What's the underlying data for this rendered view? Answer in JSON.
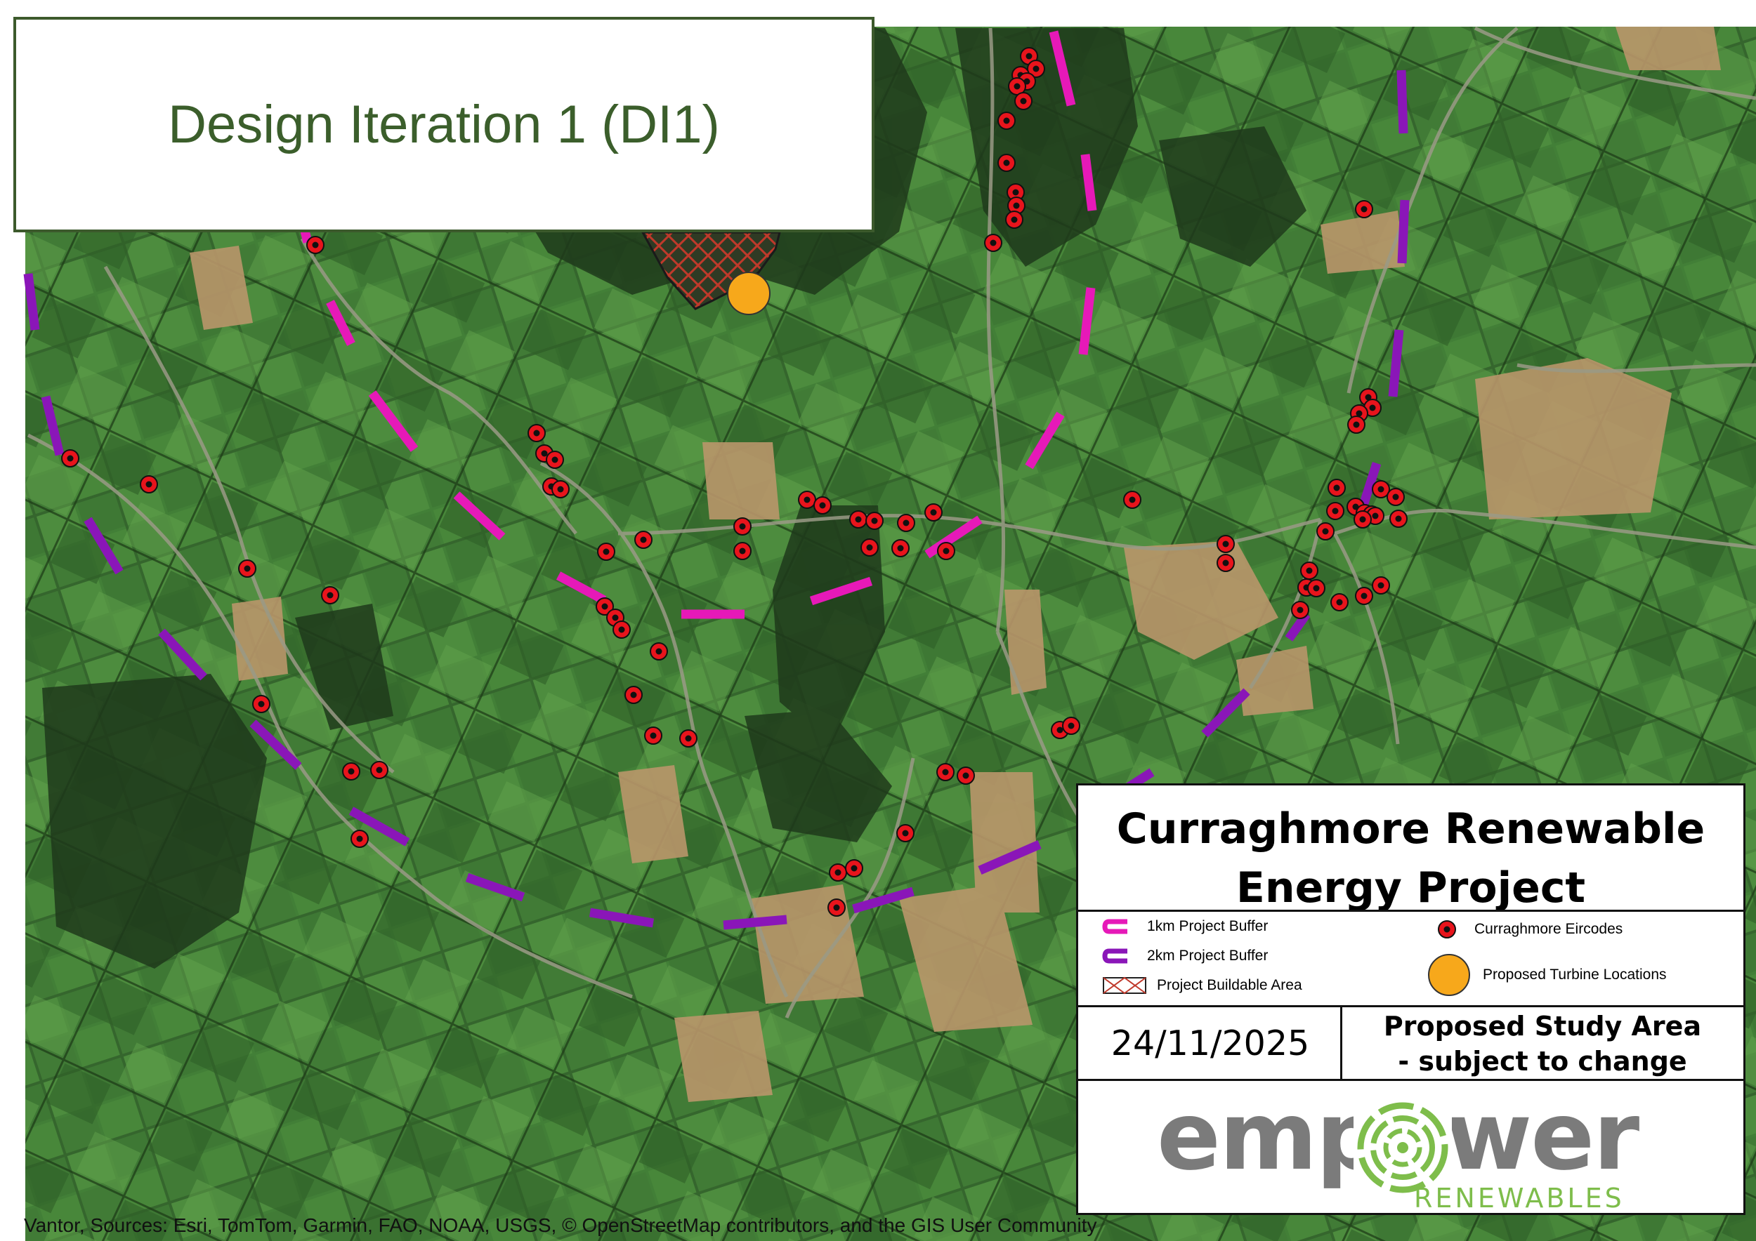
{
  "map": {
    "title": "Design Iteration 1 (DI1)",
    "attribution": "Vantor, Sources: Esri, TomTom, Garmin, FAO, NOAA, USGS, © OpenStreetMap contributors, and the GIS User Community",
    "colors": {
      "buffer_1km": "#e619b8",
      "buffer_2km": "#8a16b8",
      "eircode_fill": "#e8141c",
      "turbine_fill": "#f7a81b",
      "buildable_hatch": "#c0392b",
      "title_text": "#3b5e2b"
    }
  },
  "legend": {
    "project_title": "Curraghmore Renewable Energy Project",
    "items": [
      {
        "label": "1km Project Buffer",
        "icon": "buffer-1km-icon"
      },
      {
        "label": "2km Project Buffer",
        "icon": "buffer-2km-icon"
      },
      {
        "label": "Project Buildable Area",
        "icon": "buildable-area-icon"
      },
      {
        "label": "Curraghmore Eircodes",
        "icon": "eircode-point-icon"
      },
      {
        "label": "Proposed Turbine Locations",
        "icon": "turbine-point-icon"
      }
    ],
    "date": "24/11/2025",
    "study_area_line1": "Proposed Study Area",
    "study_area_line2": "- subject to change"
  },
  "logo": {
    "word": "empower",
    "sub": "RENEWABLES"
  }
}
